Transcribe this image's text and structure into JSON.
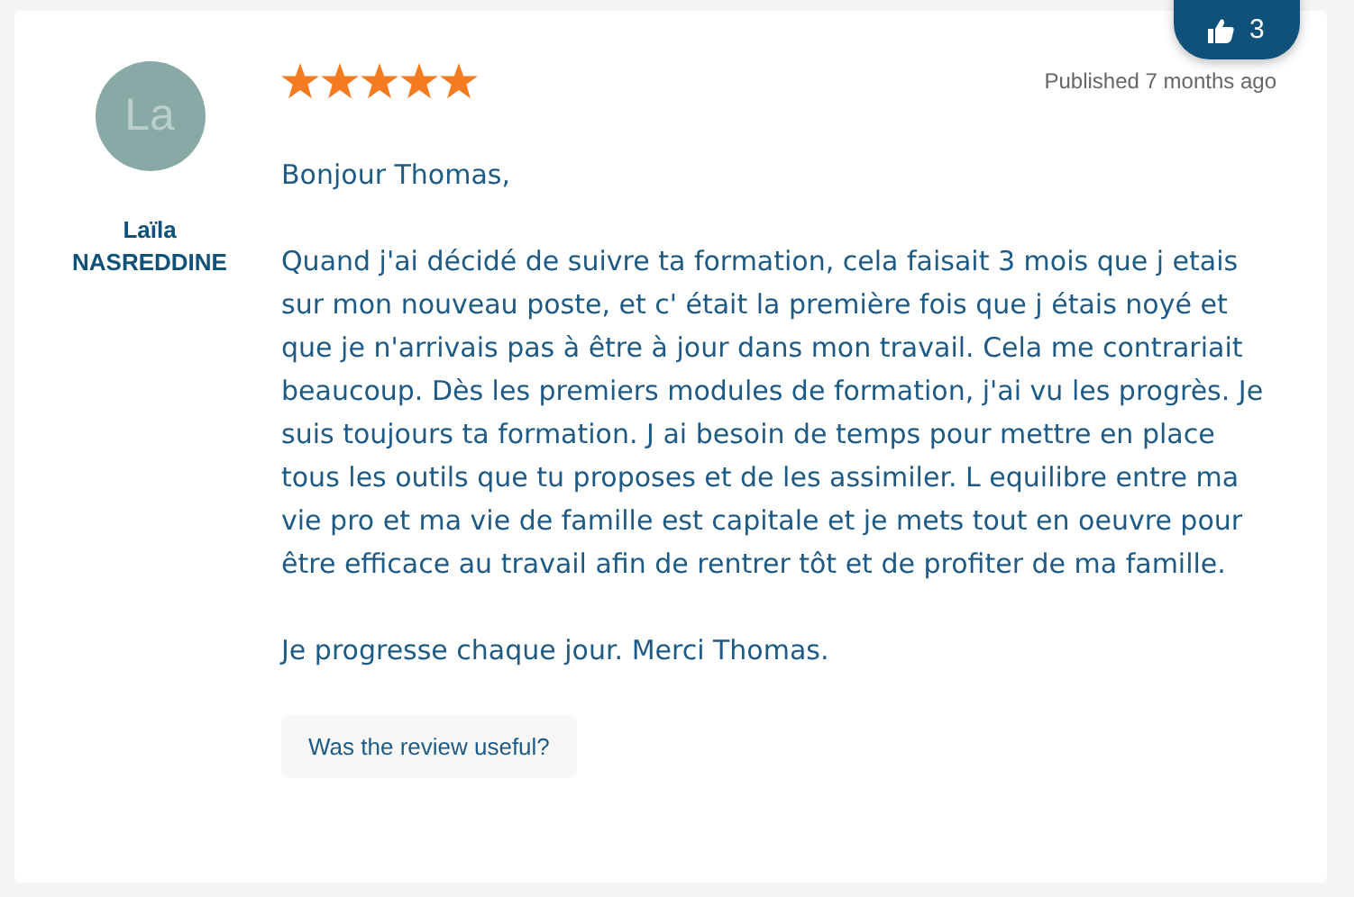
{
  "like_badge": {
    "count": "3"
  },
  "review": {
    "author": {
      "initials": "La",
      "name": "Laïla NASREDDINE"
    },
    "stars": 5,
    "published": "Published 7 months ago",
    "paragraphs": [
      "Bonjour Thomas,",
      "Quand j'ai décidé de suivre ta formation, cela faisait 3 mois que j etais sur mon nouveau poste, et c' était la première fois que j étais noyé et que je n'arrivais pas à être à jour dans mon travail. Cela me contrariait beaucoup. Dès les premiers modules de formation, j'ai vu les progrès. Je suis toujours ta formation. J ai besoin de temps pour mettre en place tous les outils que tu proposes et de les assimiler. L equilibre entre ma vie pro et ma vie de famille est capitale et je mets tout en oeuvre pour être efficace au travail afin de rentrer tôt et de profiter de ma famille.",
      "Je progresse chaque jour. Merci Thomas."
    ],
    "useful_button": "Was the review useful?"
  }
}
